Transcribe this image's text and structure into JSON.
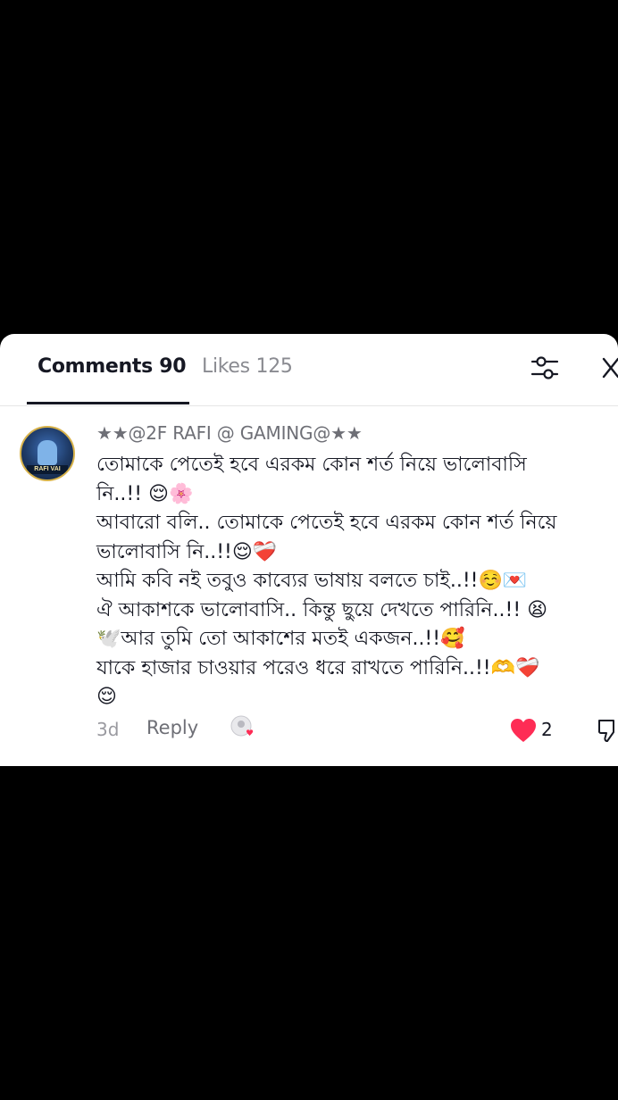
{
  "tabs": {
    "comments_label": "Comments 90",
    "likes_label": "Likes 125"
  },
  "comment": {
    "username": "★★@2F RAFI @ GAMING@★★",
    "avatar_text": "RAFI VAI",
    "lines": [
      "তোমাকে পেতেই হবে এরকম কোন শর্ত নিয়ে ভালোবাসি",
      "নি..!! 😌🌸",
      "আবারো বলি.. তোমাকে পেতেই হবে এরকম কোন শর্ত নিয়ে",
      "ভালোবাসি নি..!!😌❤️‍🩹",
      "আমি কবি নই তবুও কাব্যের ভাষায় বলতে চাই..!!☺️💌",
      "ঐ আকাশকে ভালোবাসি.. কিন্তু ছুয়ে দেখতে পারিনি..!! 😫",
      "🕊️আর তুমি তো আকাশের মতই একজন..!!🥰",
      "যাকে হাজার চাওয়ার পরেও ধরে রাখতে পারিনি..!!🫶❤️‍🩹",
      "😌"
    ],
    "time": "3d",
    "reply_label": "Reply",
    "like_count": "2"
  },
  "colors": {
    "heart": "#fe2c55",
    "text_primary": "#161823",
    "text_secondary": "#8a8b91"
  },
  "icons": {
    "filter": "sliders-icon",
    "close": "close-icon",
    "like": "heart-icon",
    "dislike": "thumbs-down-icon"
  }
}
